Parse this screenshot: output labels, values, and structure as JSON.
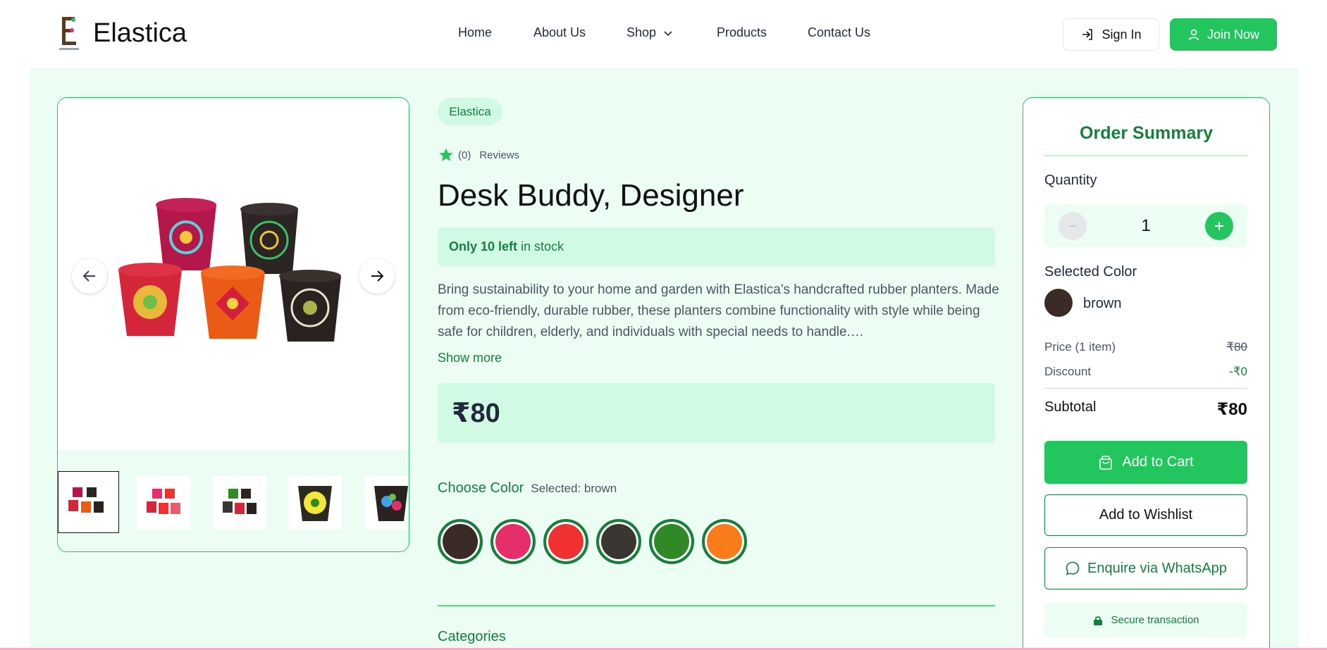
{
  "header": {
    "brand": "Elastica",
    "nav": [
      "Home",
      "About Us",
      "Shop",
      "Products",
      "Contact Us"
    ],
    "sign_in": "Sign In",
    "join_now": "Join Now"
  },
  "product": {
    "brand_badge": "Elastica",
    "rating_count": "(0)",
    "reviews_label": "Reviews",
    "title": "Desk Buddy, Designer",
    "stock_bold": "Only 10 left",
    "stock_rest": "in stock",
    "description": "Bring sustainability to your home and garden with Elastica's handcrafted rubber planters. Made from eco-friendly, durable rubber, these planters combine functionality with style while being safe for children, elderly, and individuals with special needs to handle.…",
    "show_more": "Show more",
    "price": "₹80",
    "choose_color_label": "Choose Color",
    "selected_color_text": "Selected: brown",
    "colors": [
      "#3a2b27",
      "#e62e6b",
      "#ef3131",
      "#3a3632",
      "#2f8a25",
      "#f97b19"
    ],
    "categories_label": "Categories"
  },
  "gallery": {
    "thumb_count": 5
  },
  "summary": {
    "title": "Order Summary",
    "quantity_label": "Quantity",
    "quantity": "1",
    "selected_color_label": "Selected Color",
    "selected_color": "brown",
    "selected_color_hex": "#3a2b27",
    "price_label": "Price (1 item)",
    "price_value": "₹80",
    "discount_label": "Discount",
    "discount_value": "-₹0",
    "subtotal_label": "Subtotal",
    "subtotal_value": "₹80",
    "add_to_cart": "Add to Cart",
    "add_to_wishlist": "Add to Wishlist",
    "whatsapp": "Enquire via WhatsApp",
    "secure": "Secure transaction"
  },
  "colors": {
    "accent": "#22c55e",
    "accent_dark": "#15803d",
    "bg_light": "#ecfdf3"
  }
}
